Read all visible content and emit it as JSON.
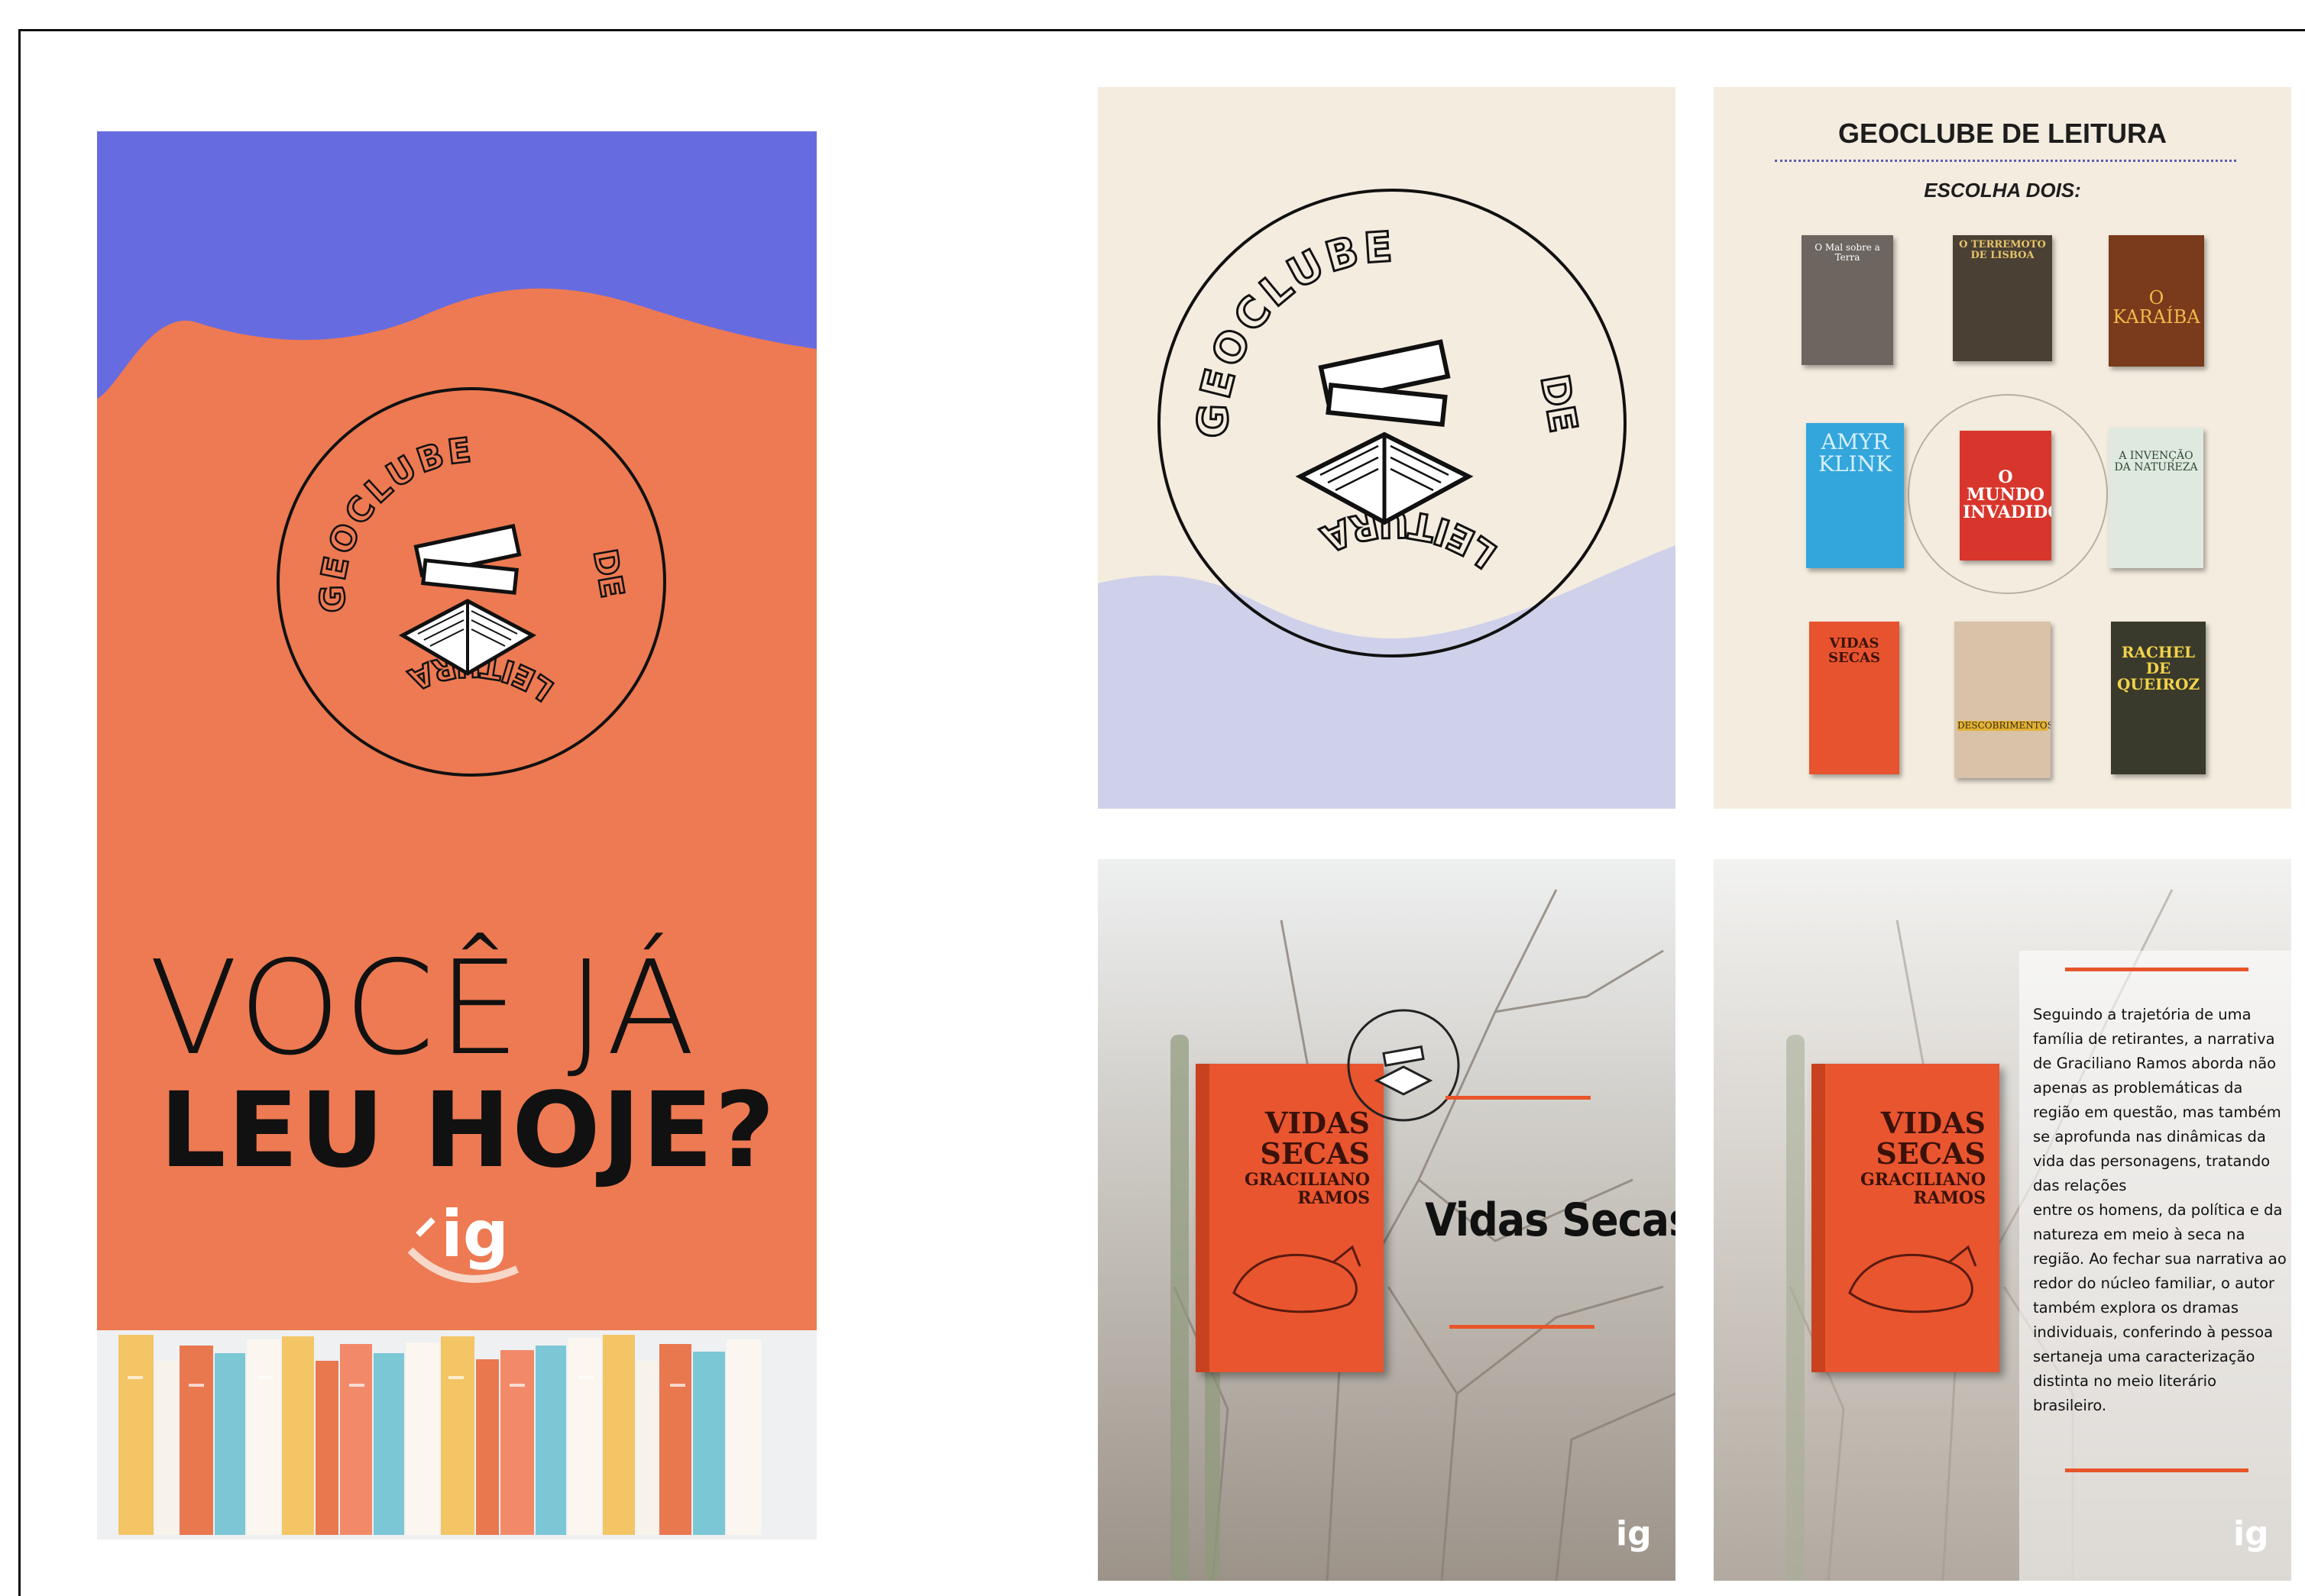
{
  "story": {
    "logo_top": "GEOCLUBE",
    "logo_right": "DE",
    "logo_bottom": "LEITURA",
    "line1": "VOCÊ JÁ",
    "line2": "LEU HOJE?",
    "brand": "ig"
  },
  "post1": {
    "logo_top": "GEOCLUBE",
    "logo_right": "DE",
    "logo_bottom": "LEITURA"
  },
  "post2": {
    "title": "GEOCLUBE DE LEITURA",
    "subtitle": "ESCOLHA DOIS:",
    "books": [
      {
        "title": "O Mal sobre a Terra"
      },
      {
        "title": "O TERREMOTO DE LISBOA"
      },
      {
        "title": "O KARAÍBA"
      },
      {
        "title": "AMYR KLINK"
      },
      {
        "title": "O MUNDO INVADIDO"
      },
      {
        "title": "A INVENÇÃO DA NATUREZA"
      },
      {
        "title": "VIDAS SECAS"
      },
      {
        "title": "DESCOBRIMENTOS"
      },
      {
        "title": "RACHEL DE QUEIROZ"
      }
    ]
  },
  "post3": {
    "cover_title": "VIDAS SECAS",
    "cover_author": "GRACILIANO RAMOS",
    "title": "Vidas Secas",
    "brand": "ig"
  },
  "post4": {
    "cover_title": "VIDAS SECAS",
    "cover_author": "GRACILIANO RAMOS",
    "description": "Seguindo a trajetória de uma família de retirantes, a narrativa de Graciliano Ramos aborda não apenas as problemáticas da região em questão, mas também se aprofunda nas dinâmicas da vida das personagens, tratando das relações\nentre os homens, da política e da natureza em meio à seca na região. Ao fechar sua narrativa ao redor do núcleo familiar, o autor também explora os dramas individuais, conferindo à pessoa sertaneja uma caracterização distinta no meio literário brasileiro.",
    "brand": "ig"
  },
  "colors": {
    "story_orange": "#ed7a52",
    "story_blue": "#676be0",
    "cream": "#f4ecdf",
    "lavender": "#cfd1ea",
    "accent_orange": "#e8552a"
  }
}
